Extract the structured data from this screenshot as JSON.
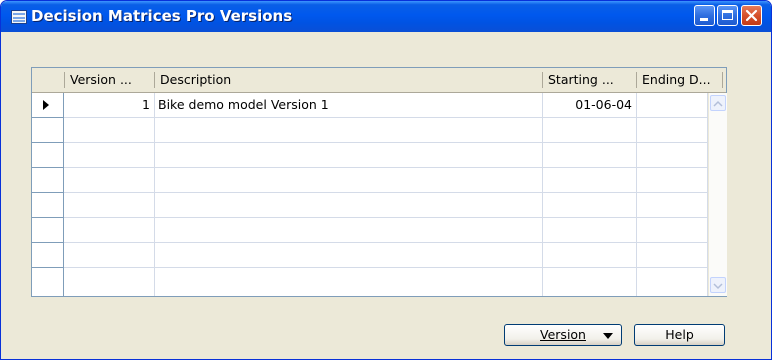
{
  "window": {
    "title": "Decision Matrices Pro Versions"
  },
  "table": {
    "columns": [
      "Version ...",
      "Description",
      "Starting ...",
      "Ending D..."
    ],
    "rows": [
      {
        "version": "1",
        "description": "Bike demo model Version  1",
        "starting": "01-06-04",
        "ending": ""
      }
    ]
  },
  "buttons": {
    "version_label": "Version",
    "help_label": "Help"
  }
}
